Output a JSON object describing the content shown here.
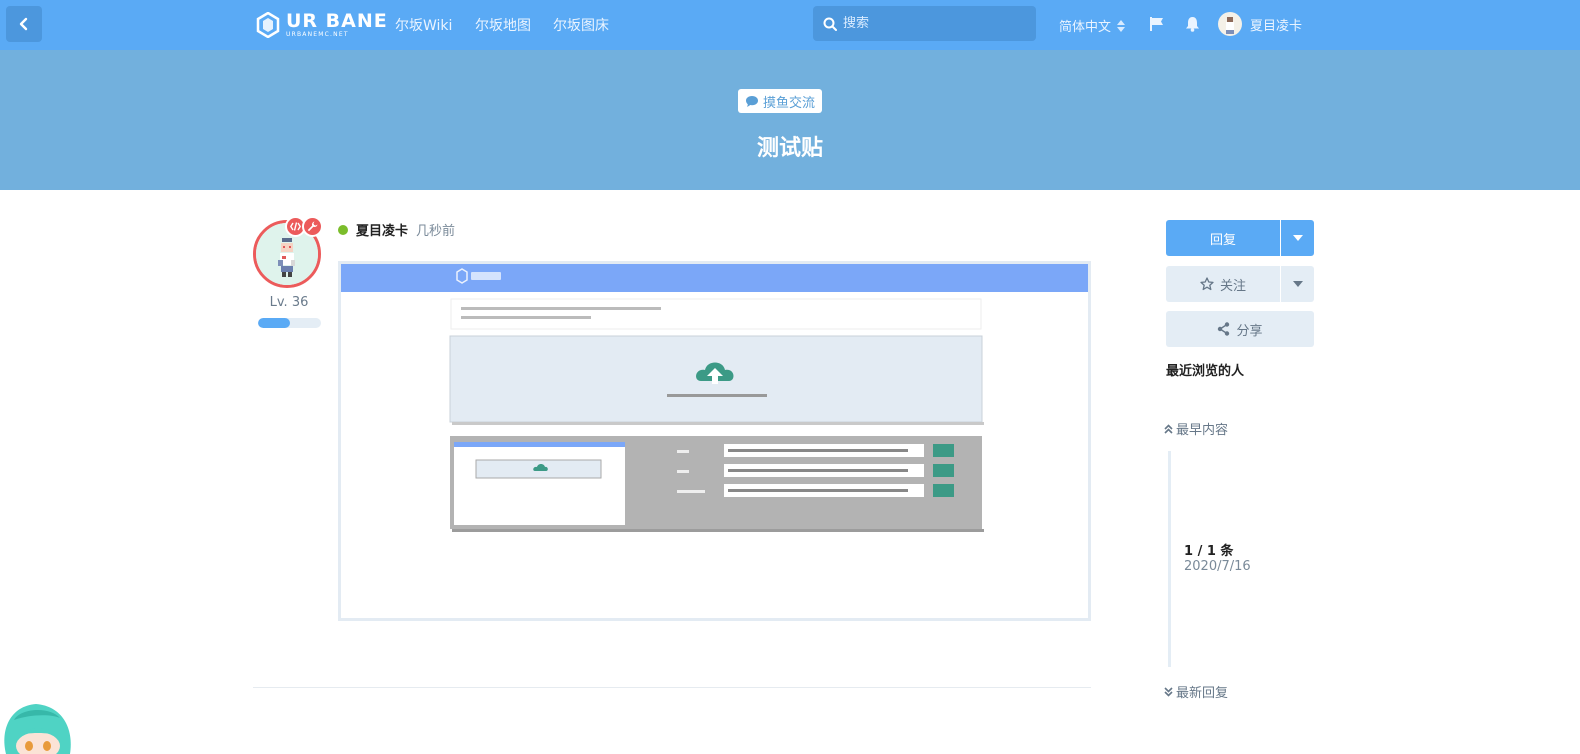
{
  "header": {
    "logo_main": "UR BANE",
    "logo_sub": "URBANEMC.NET",
    "nav": [
      "尔坂Wiki",
      "尔坂地图",
      "尔坂图床"
    ],
    "search_placeholder": "搜索",
    "language": "简体中文",
    "username": "夏目凌卡"
  },
  "discussion": {
    "tag": "摸鱼交流",
    "title": "测试贴"
  },
  "post": {
    "author": "夏目凌卡",
    "time": "几秒前",
    "level": "Lv. 36",
    "level_progress": 0.5
  },
  "sidebar": {
    "reply_label": "回复",
    "follow_label": "关注",
    "share_label": "分享",
    "viewers_title": "最近浏览的人",
    "earliest_label": "最早内容",
    "latest_label": "最新回复",
    "scrub_count": "1 / 1 条",
    "scrub_date": "2020/7/16"
  },
  "colors": {
    "header": "#5aaaf5",
    "hero": "#72b0dd",
    "primary_button": "#5aaaf5",
    "secondary_button": "#e4edf5",
    "avatar_ring": "#ec5b5b",
    "online": "#7bbd2b"
  },
  "icons": {
    "back": "chevron-left-icon",
    "search": "search-icon",
    "language_toggle": "sort-icon",
    "flag": "flag-icon",
    "notifications": "bell-icon",
    "tag": "comment-icon",
    "follow": "star-icon",
    "share": "share-icon",
    "dropdown": "caret-down-icon",
    "earliest": "double-chevron-up-icon",
    "latest": "double-chevron-down-icon",
    "badge_developer": "code-icon",
    "badge_admin": "wrench-icon"
  }
}
